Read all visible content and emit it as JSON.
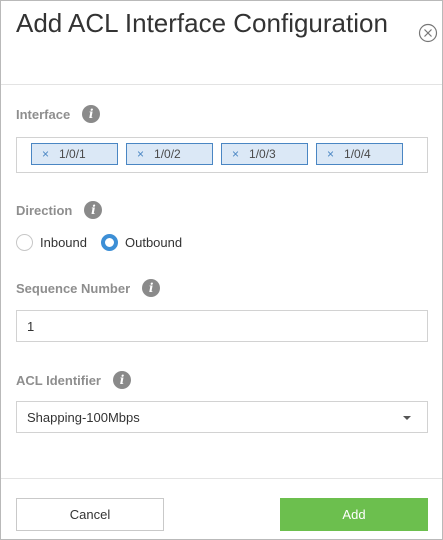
{
  "dialog": {
    "title": "Add ACL Interface Configuration",
    "close_icon": "close-circle-icon"
  },
  "interface": {
    "label": "Interface",
    "info_icon": "i",
    "tags": [
      {
        "remove": "×",
        "text": "1/0/1"
      },
      {
        "remove": "×",
        "text": "1/0/2"
      },
      {
        "remove": "×",
        "text": "1/0/3"
      },
      {
        "remove": "×",
        "text": "1/0/4"
      }
    ]
  },
  "direction": {
    "label": "Direction",
    "info_icon": "i",
    "options": [
      {
        "label": "Inbound",
        "checked": false
      },
      {
        "label": "Outbound",
        "checked": true
      }
    ]
  },
  "sequence": {
    "label": "Sequence Number",
    "info_icon": "i",
    "value": "1"
  },
  "acl_identifier": {
    "label": "ACL Identifier",
    "info_icon": "i",
    "value": "Shapping-100Mbps"
  },
  "footer": {
    "cancel_label": "Cancel",
    "add_label": "Add"
  },
  "colors": {
    "accent": "#3d8fd6",
    "tag_bg": "#dbe8f6",
    "primary_button": "#6cbf4e"
  }
}
